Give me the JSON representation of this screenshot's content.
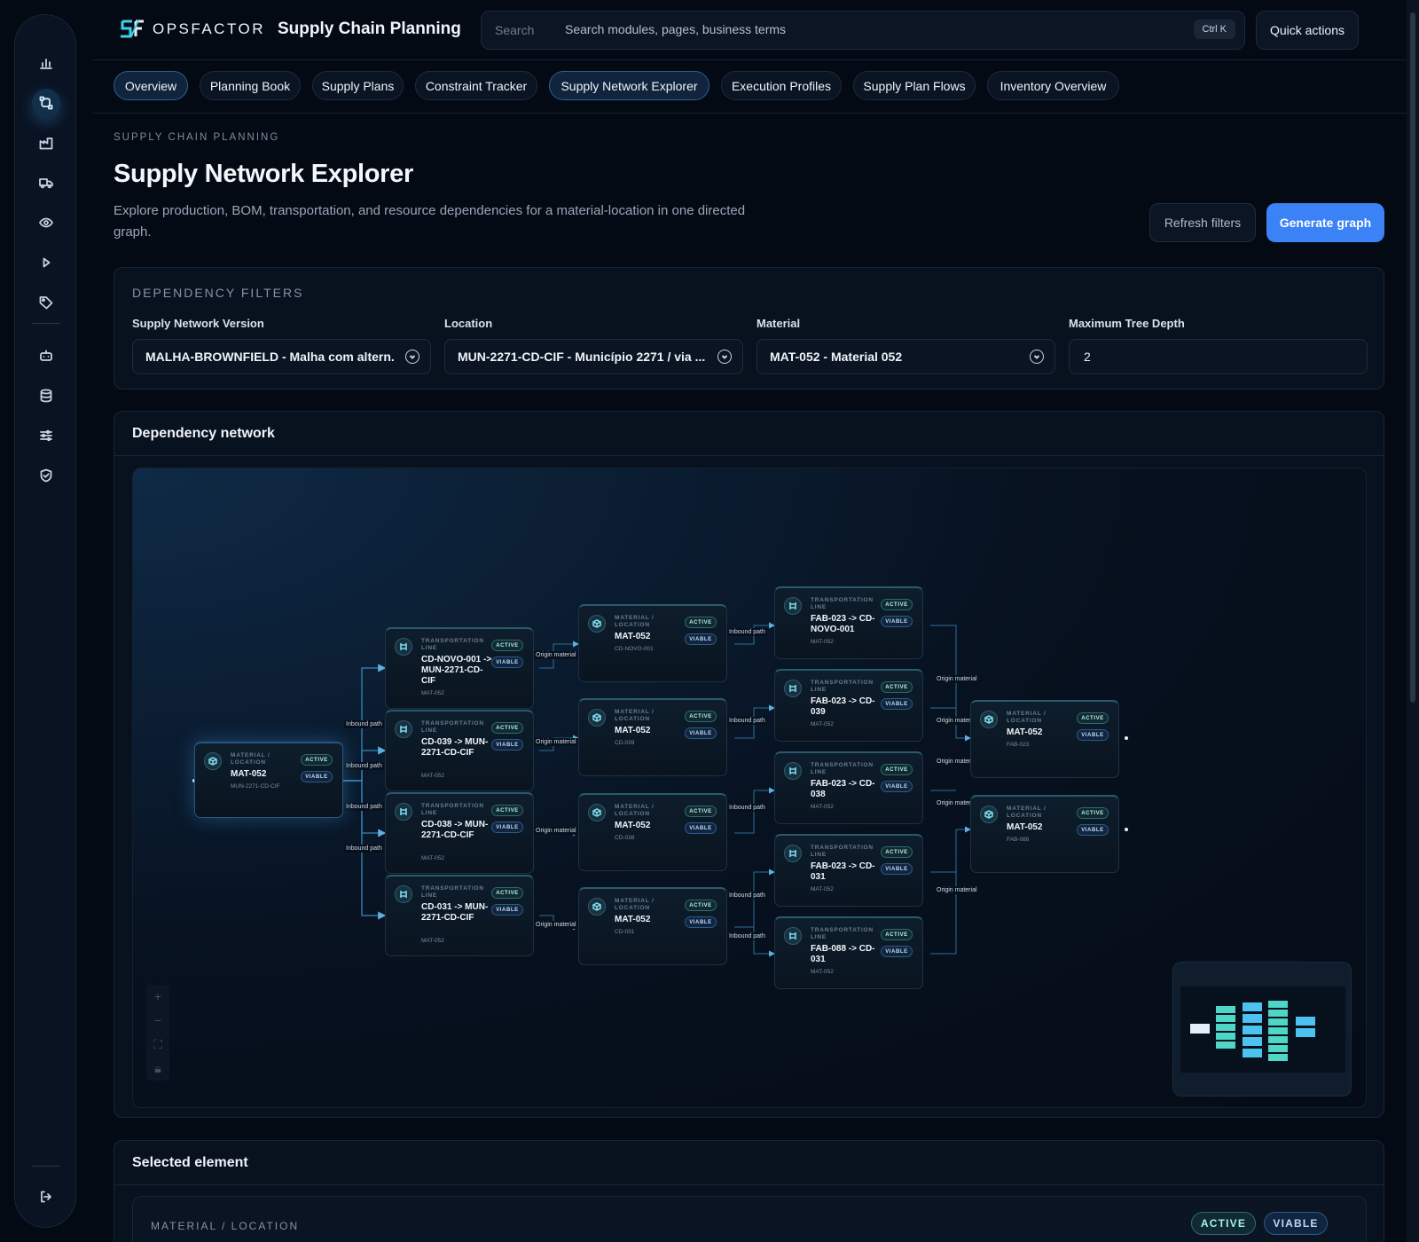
{
  "brand": {
    "name": "OPSFACTOR",
    "app_title": "Supply Chain Planning"
  },
  "search": {
    "label": "Search",
    "placeholder": "Search modules, pages, business terms",
    "shortcut": "Ctrl K"
  },
  "quick_actions": "Quick actions",
  "tabs": [
    {
      "label": "Overview",
      "active": true
    },
    {
      "label": "Planning Book"
    },
    {
      "label": "Supply Plans"
    },
    {
      "label": "Constraint Tracker"
    },
    {
      "label": "Supply Network Explorer",
      "active": true
    },
    {
      "label": "Execution Profiles"
    },
    {
      "label": "Supply Plan Flows"
    },
    {
      "label": "Inventory Overview"
    }
  ],
  "sidebar_icons": [
    "chart-icon",
    "network-icon",
    "factory-icon",
    "truck-icon",
    "eye-icon",
    "play-icon",
    "tag-icon",
    "robot-icon",
    "database-icon",
    "sliders-icon",
    "shield-check-icon",
    "logout-icon"
  ],
  "page": {
    "eyebrow": "SUPPLY CHAIN PLANNING",
    "title": "Supply Network Explorer",
    "description": "Explore production, BOM, transportation, and resource dependencies for a material-location in one directed graph.",
    "refresh_label": "Refresh filters",
    "generate_label": "Generate graph"
  },
  "filters": {
    "title": "DEPENDENCY FILTERS",
    "version": {
      "label": "Supply Network Version",
      "value": "MALHA-BROWNFIELD - Malha com altern..."
    },
    "location": {
      "label": "Location",
      "value": "MUN-2271-CD-CIF - Município 2271 / via ..."
    },
    "material": {
      "label": "Material",
      "value": "MAT-052 - Material 052"
    },
    "depth": {
      "label": "Maximum Tree Depth",
      "value": "2"
    }
  },
  "network": {
    "title": "Dependency network",
    "badge_active": "ACTIVE",
    "badge_viable": "VIABLE",
    "edge_labels": {
      "inbound": "Inbound path",
      "origin": "Origin material"
    },
    "nodes": {
      "root": {
        "kind": "MATERIAL / LOCATION",
        "title": "MAT-052",
        "sub": "MUN-2271-CD-CIF"
      },
      "t1": {
        "kind": "TRANSPORTATION LINE",
        "title": "CD-NOVO-001 -> MUN-2271-CD-CIF",
        "sub": "MAT-052"
      },
      "t2": {
        "kind": "TRANSPORTATION LINE",
        "title": "CD-039 -> MUN-2271-CD-CIF",
        "sub": "MAT-052"
      },
      "t3": {
        "kind": "TRANSPORTATION LINE",
        "title": "CD-038 -> MUN-2271-CD-CIF",
        "sub": "MAT-052"
      },
      "t4": {
        "kind": "TRANSPORTATION LINE",
        "title": "CD-031 -> MUN-2271-CD-CIF",
        "sub": "MAT-052"
      },
      "m1": {
        "kind": "MATERIAL / LOCATION",
        "title": "MAT-052",
        "sub": "CD-NOVO-001"
      },
      "m2": {
        "kind": "MATERIAL / LOCATION",
        "title": "MAT-052",
        "sub": "CD-039"
      },
      "m3": {
        "kind": "MATERIAL / LOCATION",
        "title": "MAT-052",
        "sub": "CD-038"
      },
      "m4": {
        "kind": "MATERIAL / LOCATION",
        "title": "MAT-052",
        "sub": "CD-031"
      },
      "f1": {
        "kind": "TRANSPORTATION LINE",
        "title": "FAB-023 -> CD-NOVO-001",
        "sub": "MAT-052"
      },
      "f2": {
        "kind": "TRANSPORTATION LINE",
        "title": "FAB-023 -> CD-039",
        "sub": "MAT-052"
      },
      "f3": {
        "kind": "TRANSPORTATION LINE",
        "title": "FAB-023 -> CD-038",
        "sub": "MAT-052"
      },
      "f4": {
        "kind": "TRANSPORTATION LINE",
        "title": "FAB-023 -> CD-031",
        "sub": "MAT-052"
      },
      "f5": {
        "kind": "TRANSPORTATION LINE",
        "title": "FAB-088 -> CD-031",
        "sub": "MAT-052"
      },
      "s1": {
        "kind": "MATERIAL / LOCATION",
        "title": "MAT-052",
        "sub": "FAB-023"
      },
      "s2": {
        "kind": "MATERIAL / LOCATION",
        "title": "MAT-052",
        "sub": "FAB-088"
      }
    }
  },
  "selected": {
    "title": "Selected element",
    "kind": "MATERIAL / LOCATION",
    "badge_active": "ACTIVE",
    "badge_viable": "VIABLE"
  }
}
